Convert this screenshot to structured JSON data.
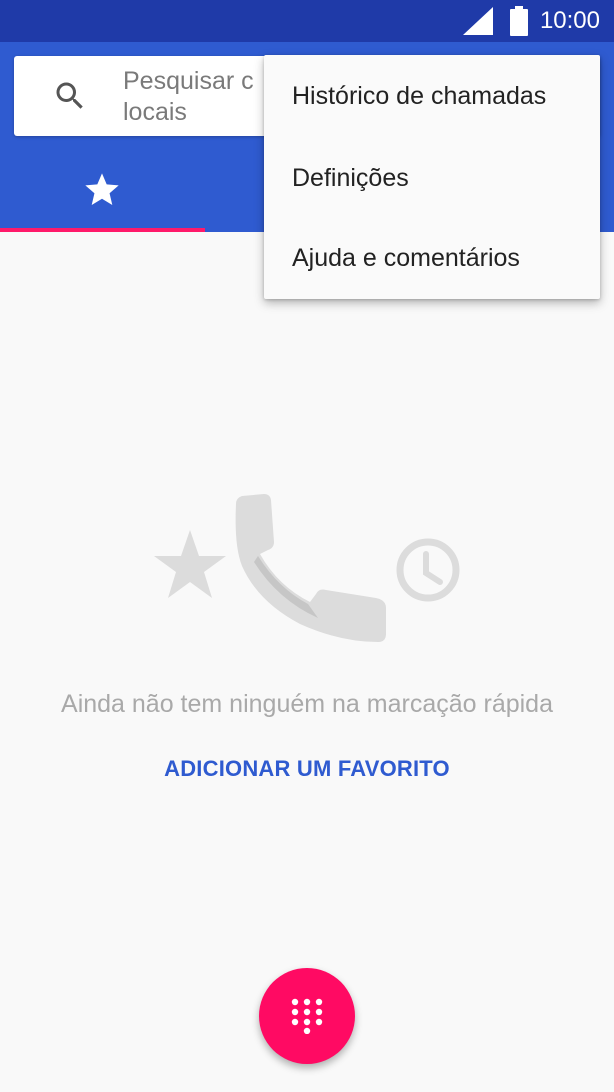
{
  "status_bar": {
    "time": "10:00",
    "icons": [
      "signal-icon",
      "battery-icon"
    ]
  },
  "search": {
    "placeholder_line1": "Pesquisar c",
    "placeholder_line2": "locais",
    "icon": "search-icon"
  },
  "tabs": {
    "active_icon": "star-icon"
  },
  "menu": {
    "items": [
      {
        "label": "Histórico de chamadas"
      },
      {
        "label": "Definições"
      },
      {
        "label": "Ajuda e comentários"
      }
    ]
  },
  "empty_state": {
    "message": "Ainda não tem ninguém na marcação rápida",
    "action_label": "ADICIONAR UM FAVORITO",
    "illustration_icons": [
      "star-icon",
      "phone-icon",
      "clock-icon"
    ]
  },
  "fab": {
    "icon": "dialpad-icon"
  },
  "colors": {
    "status_bar": "#1f3aa8",
    "app_bar": "#2f5bd0",
    "accent": "#ff0a63",
    "tab_indicator": "#ff1a6a",
    "link": "#2f5bd0"
  }
}
